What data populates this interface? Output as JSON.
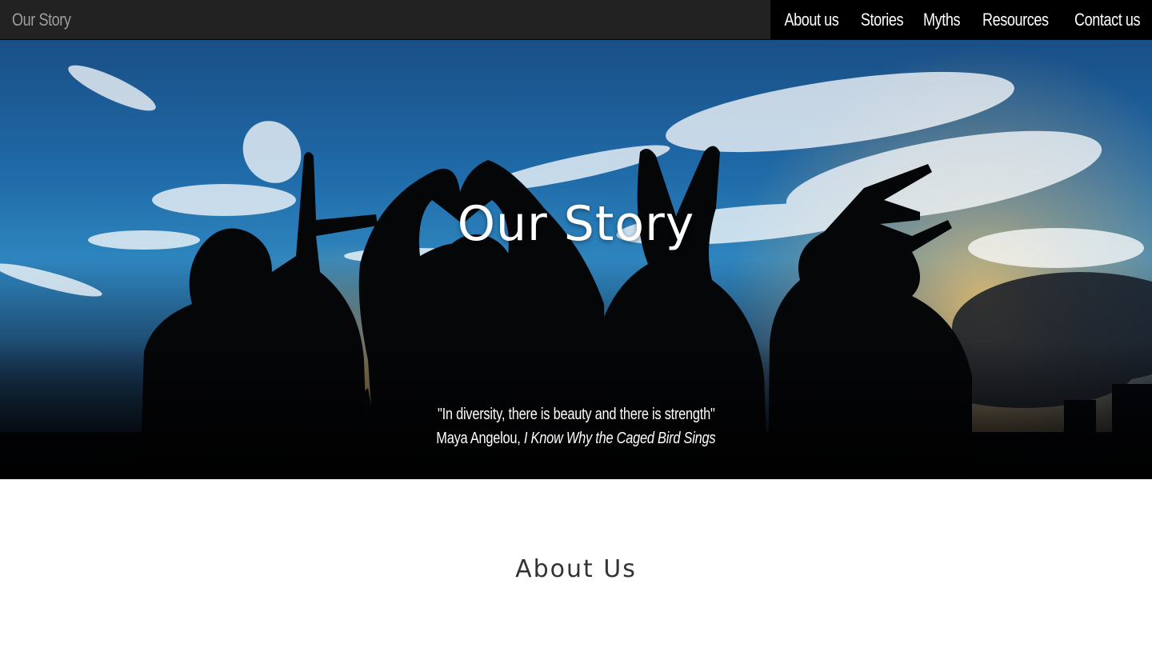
{
  "navbar": {
    "brand": "Our Story",
    "items": [
      {
        "label": "About us"
      },
      {
        "label": "Stories"
      },
      {
        "label": "Myths"
      },
      {
        "label": "Resources"
      },
      {
        "label": "Contact us"
      }
    ]
  },
  "hero": {
    "title": "Our Story",
    "quote_text": "\"In diversity, there is beauty and there is strength\"",
    "quote_author": "Maya Angelou,",
    "quote_source": "I Know Why the Caged Bird Sings"
  },
  "about": {
    "title": "About Us"
  },
  "colors": {
    "navbar_bg": "#222222",
    "nav_active_bg": "#000000",
    "brand_text": "#9d9d9d",
    "nav_text": "#ffffff",
    "heading_text": "#333333"
  }
}
